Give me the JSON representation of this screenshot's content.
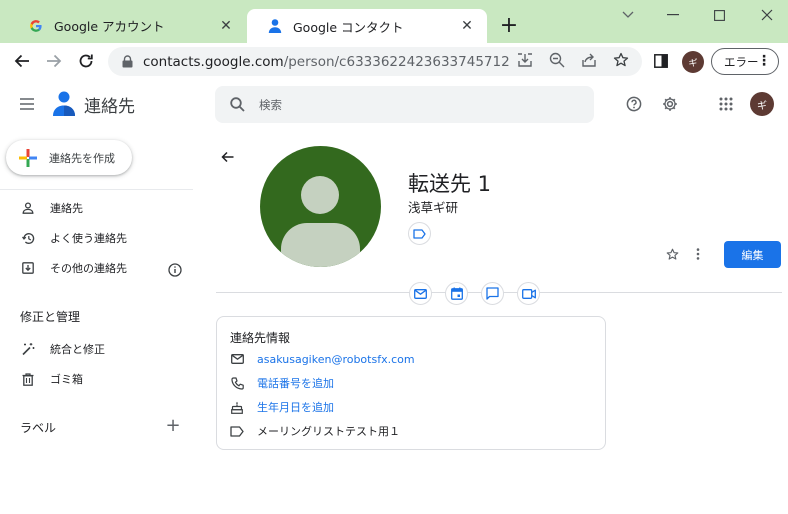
{
  "browser": {
    "tabs": [
      {
        "title": "Google アカウント",
        "active": false
      },
      {
        "title": "Google コンタクト",
        "active": true
      }
    ],
    "url_host": "contacts.google.com",
    "url_path": "/person/c6333622423633745712",
    "profile_initial": "ギ",
    "error_button": "エラー"
  },
  "app": {
    "title": "連絡先",
    "search_placeholder": "検索",
    "profile_initial": "ギ"
  },
  "sidebar": {
    "create_label": "連絡先を作成",
    "items": [
      {
        "label": "連絡先",
        "icon": "person-icon"
      },
      {
        "label": "よく使う連絡先",
        "icon": "history-icon"
      },
      {
        "label": "その他の連絡先",
        "icon": "import-icon"
      }
    ],
    "section_manage": "修正と管理",
    "manage_items": [
      {
        "label": "統合と修正",
        "icon": "magic-wand-icon"
      },
      {
        "label": "ゴミ箱",
        "icon": "trash-icon"
      }
    ],
    "section_labels": "ラベル"
  },
  "contact": {
    "name": "転送先 1",
    "organization": "浅草ギ研",
    "edit_label": "編集",
    "info_title": "連絡先情報",
    "email": "asakusagiken@robotsfx.com",
    "add_phone": "電話番号を追加",
    "add_birthday": "生年月日を追加",
    "label_name": "メーリングリストテスト用１"
  },
  "colors": {
    "tabstrip": "#c9e8c1",
    "accent": "#1a73e8",
    "avatar_bg": "#33691e"
  }
}
